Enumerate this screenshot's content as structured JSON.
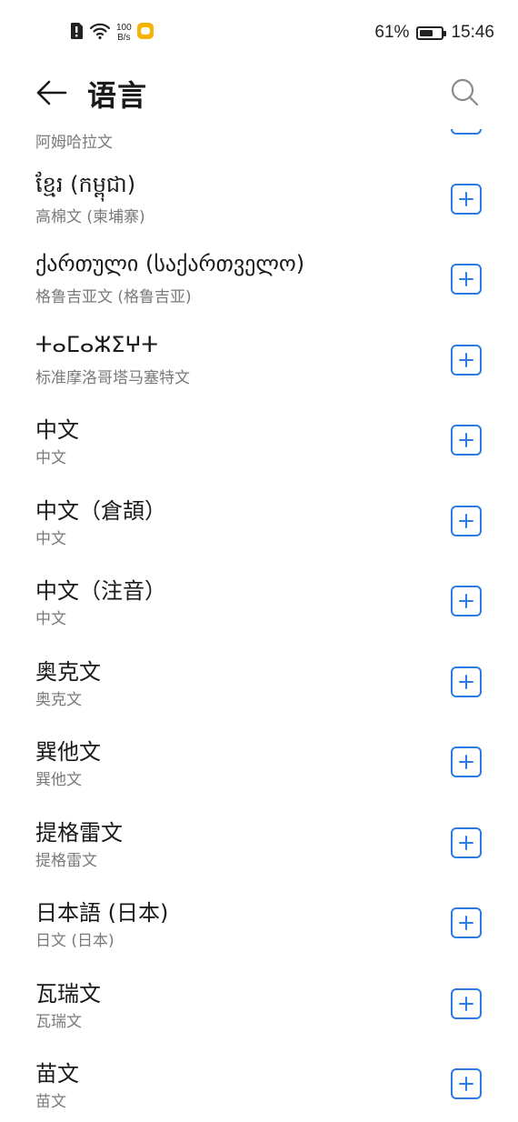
{
  "status_bar": {
    "net_speed_value": "100",
    "net_speed_unit": "B/s",
    "battery_percent": "61%",
    "battery_level": 0.61,
    "time": "15:46"
  },
  "header": {
    "title": "语言"
  },
  "partial_item": {
    "subtitle": "阿姆哈拉文"
  },
  "languages": [
    {
      "name": "ខ្មែរ (កម្ពុជា)",
      "subtitle": "高棉文 (柬埔寨)"
    },
    {
      "name": "ქართული (საქართველო)",
      "subtitle": "格鲁吉亚文 (格鲁吉亚)"
    },
    {
      "name": "ⵜⴰⵎⴰⵣⵉⵖⵜ",
      "subtitle": "标准摩洛哥塔马塞特文"
    },
    {
      "name": "中文",
      "subtitle": "中文"
    },
    {
      "name": "中文（倉頡）",
      "subtitle": "中文"
    },
    {
      "name": "中文（注音）",
      "subtitle": "中文"
    },
    {
      "name": "奥克文",
      "subtitle": "奥克文"
    },
    {
      "name": "巽他文",
      "subtitle": "巽他文"
    },
    {
      "name": "提格雷文",
      "subtitle": "提格雷文"
    },
    {
      "name": "日本語 (日本)",
      "subtitle": "日文 (日本)"
    },
    {
      "name": "瓦瑞文",
      "subtitle": "瓦瑞文"
    },
    {
      "name": "苗文",
      "subtitle": "苗文"
    }
  ],
  "colors": {
    "accent": "#2a7be4",
    "subtitle": "#7a7a7a"
  }
}
